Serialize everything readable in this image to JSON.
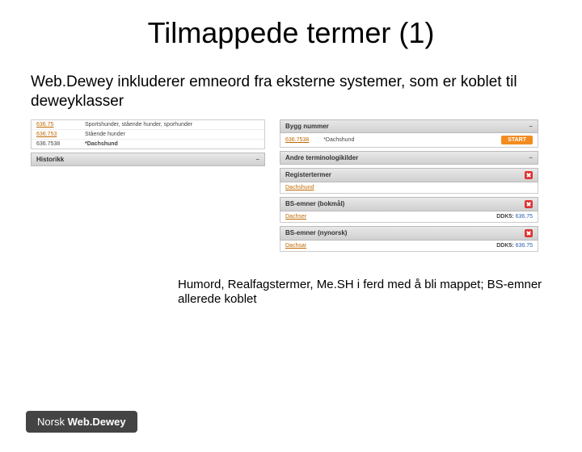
{
  "title": "Tilmappede termer (1)",
  "subtitle": "Web.Dewey inkluderer emneord fra eksterne systemer, som er koblet til deweyklasser",
  "left": {
    "rows": [
      {
        "num": "636.75",
        "text": "Sportshunder, stående hunder, sporhunder",
        "link": true,
        "bold": false
      },
      {
        "num": "636.753",
        "text": "Stående hunder",
        "link": true,
        "bold": false
      },
      {
        "num": "636.7538",
        "text": "*Dachshund",
        "link": false,
        "bold": true
      }
    ],
    "historikk": "Historikk"
  },
  "right": {
    "bygg": {
      "header": "Bygg nummer",
      "num": "636.7538",
      "text": "*Dachshund",
      "start": "START"
    },
    "andre_header": "Andre terminologikilder",
    "sections": [
      {
        "header": "Registertermer",
        "term": "Dachshund",
        "ddk_label": "",
        "ddk_val": ""
      },
      {
        "header": "BS-emner (bokmål)",
        "term": "Dachser",
        "ddk_label": "DDK5:",
        "ddk_val": "636.75"
      },
      {
        "header": "BS-emner (nynorsk)",
        "term": "Dachsar",
        "ddk_label": "DDK5:",
        "ddk_val": "636.75"
      }
    ]
  },
  "footnote": "Humord, Realfagstermer, Me.SH i ferd med å bli mappet; BS-emner allerede koblet",
  "logo": {
    "a": "Norsk ",
    "b": "Web.Dewey"
  }
}
